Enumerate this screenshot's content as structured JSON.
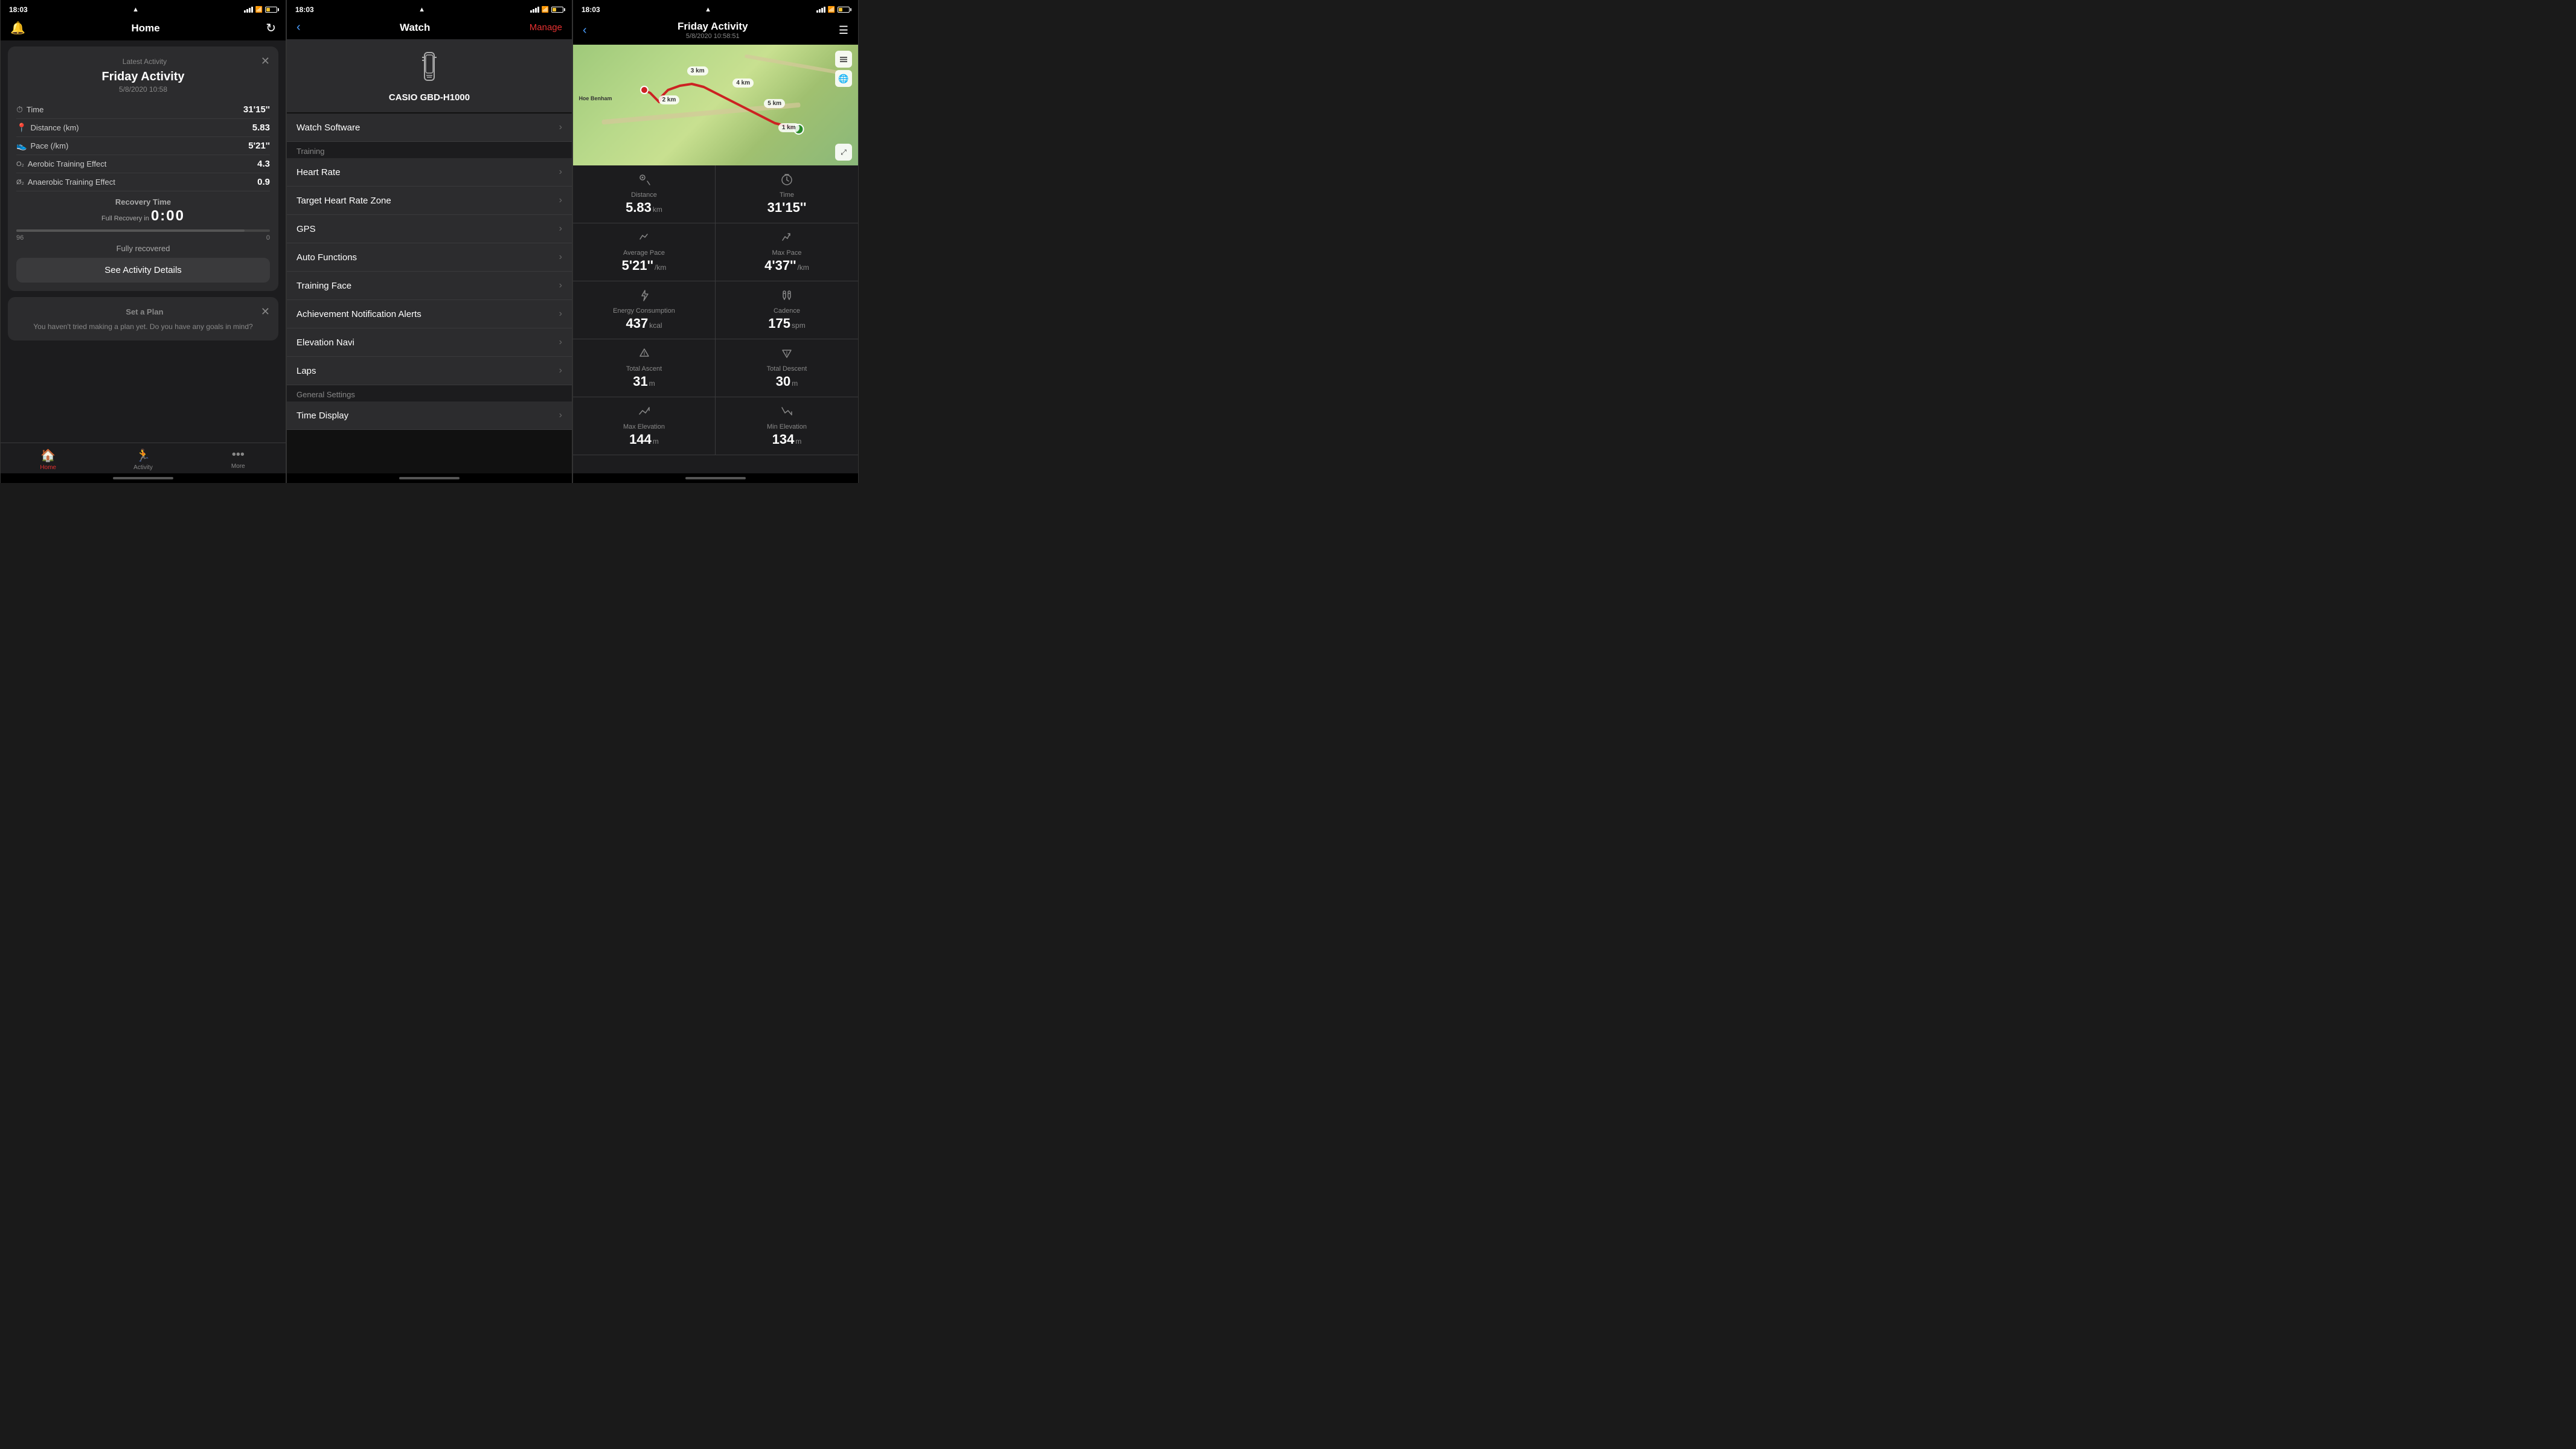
{
  "screen1": {
    "statusBar": {
      "time": "18:03",
      "location": "▲"
    },
    "header": {
      "title": "Home"
    },
    "activityCard": {
      "label": "Latest Activity",
      "name": "Friday Activity",
      "date": "5/8/2020 10:58",
      "stats": [
        {
          "icon": "⏱",
          "label": "Time",
          "value": "31'15''"
        },
        {
          "icon": "📍",
          "label": "Distance (km)",
          "value": "5.83"
        },
        {
          "icon": "🐾",
          "label": "Pace (/km)",
          "value": "5'21''"
        },
        {
          "icon": "O₂",
          "label": "Aerobic Training Effect",
          "value": "4.3"
        },
        {
          "icon": "Ø",
          "label": "Anaerobic Training Effect",
          "value": "0.9"
        }
      ],
      "recoveryLabel": "Recovery Time",
      "recoverySubLabel": "Full Recovery in",
      "recoveryTime": "0:00",
      "progressLeft": "96",
      "progressRight": "0",
      "fullyRecovered": "Fully recovered",
      "detailsBtn": "See Activity Details"
    },
    "planCard": {
      "label": "Set a Plan",
      "desc": "You haven't tried making a plan yet. Do you have any goals in mind?"
    },
    "tabs": [
      {
        "icon": "🏠",
        "label": "Home",
        "active": true
      },
      {
        "icon": "🏃",
        "label": "Activity",
        "active": false
      },
      {
        "icon": "•••",
        "label": "More",
        "active": false
      }
    ]
  },
  "screen2": {
    "statusBar": {
      "time": "18:03"
    },
    "header": {
      "back": "‹",
      "title": "Watch",
      "manage": "Manage"
    },
    "device": {
      "icon": "⌚",
      "name": "CASIO GBD-H1000"
    },
    "menuItems": [
      {
        "label": "Watch Software"
      },
      {
        "label": "Heart Rate"
      },
      {
        "label": "Target Heart Rate Zone"
      },
      {
        "label": "GPS"
      },
      {
        "label": "Auto Functions"
      },
      {
        "label": "Training Face"
      },
      {
        "label": "Achievement Notification Alerts"
      },
      {
        "label": "Elevation Navi"
      },
      {
        "label": "Laps"
      }
    ],
    "sections": {
      "training": "Training",
      "generalSettings": "General Settings"
    },
    "generalItems": [
      {
        "label": "Time Display"
      }
    ]
  },
  "screen3": {
    "statusBar": {
      "time": "18:03"
    },
    "header": {
      "back": "‹",
      "title": "Friday Activity",
      "subtitle": "5/8/2020 10:58:51"
    },
    "stats": [
      {
        "icon": "📍",
        "label": "Distance",
        "value": "5.83",
        "unit": "km"
      },
      {
        "icon": "⏱",
        "label": "Time",
        "value": "31'15''",
        "unit": ""
      },
      {
        "icon": "🐾",
        "label": "Average Pace",
        "value": "5'21''",
        "unit": "/km"
      },
      {
        "icon": "⚡",
        "label": "Max Pace",
        "value": "4'37''",
        "unit": "/km"
      },
      {
        "icon": "🔥",
        "label": "Energy Consumption",
        "value": "437",
        "unit": "kcal"
      },
      {
        "icon": "👣",
        "label": "Cadence",
        "value": "175",
        "unit": "spm"
      },
      {
        "icon": "△",
        "label": "Total Ascent",
        "value": "31",
        "unit": "m"
      },
      {
        "icon": "▽",
        "label": "Total Descent",
        "value": "30",
        "unit": "m"
      },
      {
        "icon": "⬆",
        "label": "Max Elevation",
        "value": "144",
        "unit": "m"
      },
      {
        "icon": "⬇",
        "label": "Min Elevation",
        "value": "134",
        "unit": "m"
      }
    ],
    "map": {
      "kmLabels": [
        {
          "label": "1 km",
          "top": "65%",
          "left": "55%"
        },
        {
          "label": "2 km",
          "top": "45%",
          "left": "32%"
        },
        {
          "label": "3 km",
          "top": "20%",
          "left": "42%"
        },
        {
          "label": "4 km",
          "top": "30%",
          "left": "58%"
        },
        {
          "label": "5 km",
          "top": "50%",
          "left": "72%"
        }
      ]
    }
  }
}
